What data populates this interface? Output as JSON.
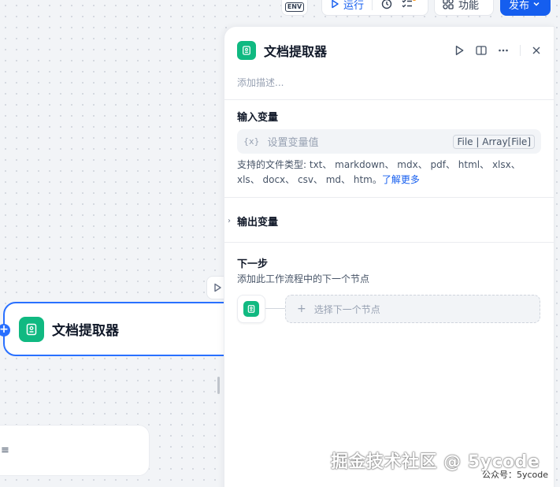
{
  "toolbar": {
    "env_label": "ENV",
    "run_label": "运行",
    "features_label": "功能",
    "publish_label": "发布",
    "accent": "#155eef"
  },
  "canvas": {
    "node_title": "文档提取器",
    "bottom_card_mark": "≡"
  },
  "panel": {
    "title": "文档提取器",
    "description_placeholder": "添加描述...",
    "input_section_label": "输入变量",
    "input_placeholder": "设置变量值",
    "input_type_tag": "File | Array[File]",
    "supported_text": "支持的文件类型: txt、 markdown、 mdx、 pdf、 html、 xlsx、 xls、 docx、 csv、 md、 htm。",
    "learn_more": "了解更多",
    "output_section_label": "输出变量",
    "next_section_label": "下一步",
    "next_desc": "添加此工作流程中的下一个节点",
    "select_next_placeholder": "选择下一个节点"
  },
  "watermark": {
    "main": "掘金技术社区 @ 5ycode",
    "sub": "公众号：5ycode"
  },
  "icons": [
    "env-icon",
    "play-icon",
    "history-icon",
    "checklist-icon",
    "features-icon",
    "chevron-down-icon",
    "doc-extractor-icon",
    "split-view-icon",
    "more-icon",
    "close-icon",
    "variable-icon",
    "plus-icon"
  ]
}
